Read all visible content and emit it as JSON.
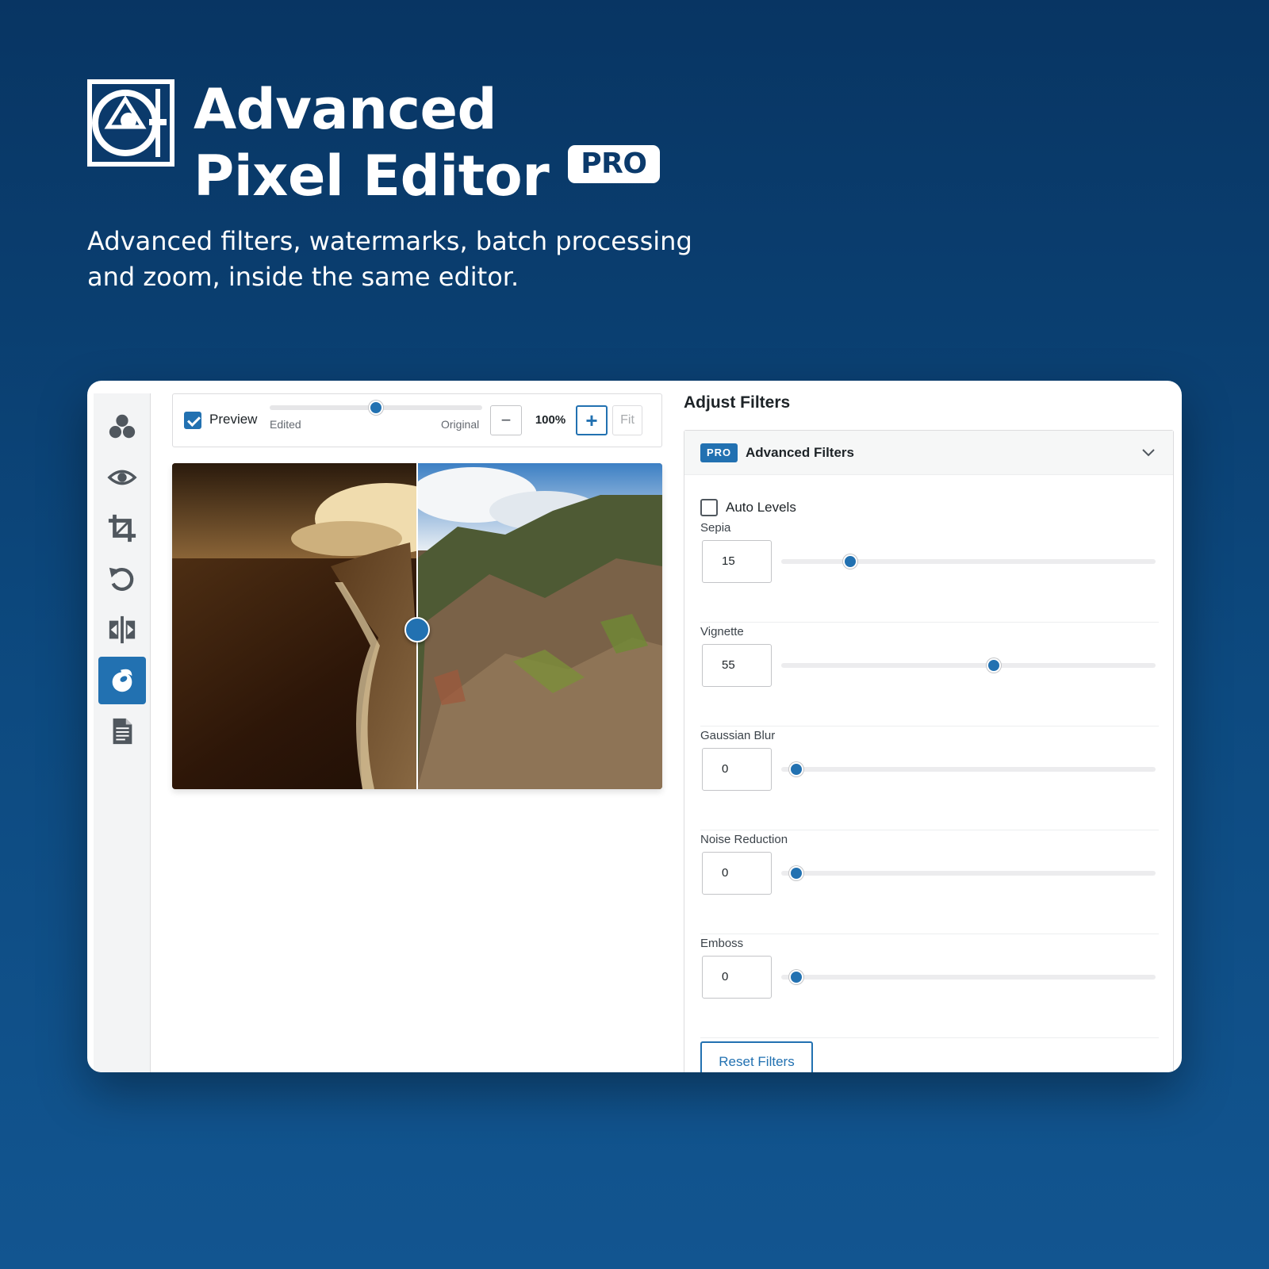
{
  "hero": {
    "title_line1": "Advanced",
    "title_line2": "Pixel Editor",
    "badge": "PRO",
    "subtitle": "Advanced filters, watermarks, batch processing and zoom, inside the same editor.",
    "logo_icon": "camera-aperture-logo"
  },
  "sidebar": {
    "items": [
      {
        "icon": "circles-icon",
        "active": false
      },
      {
        "icon": "eye-icon",
        "active": false
      },
      {
        "icon": "crop-icon",
        "active": false
      },
      {
        "icon": "rotate-icon",
        "active": false
      },
      {
        "icon": "flip-icon",
        "active": false
      },
      {
        "icon": "filter-icon",
        "active": true
      },
      {
        "icon": "document-icon",
        "active": false
      }
    ]
  },
  "toolbar": {
    "preview_label": "Preview",
    "preview_checked": true,
    "compare_slider_value": 0.5,
    "edited_label": "Edited",
    "original_label": "Original",
    "zoom_out": "−",
    "zoom_level": "100%",
    "zoom_in": "+",
    "fit_label": "Fit"
  },
  "image": {
    "split_position": 0.5
  },
  "panel": {
    "heading": "Adjust Filters",
    "section_badge": "PRO",
    "section_title": "Advanced Filters",
    "auto_levels_label": "Auto Levels",
    "auto_levels_checked": false,
    "filters": [
      {
        "label": "Sepia",
        "value": "15",
        "max": 100
      },
      {
        "label": "Vignette",
        "value": "55",
        "max": 100
      },
      {
        "label": "Gaussian Blur",
        "value": "0",
        "max": 100
      },
      {
        "label": "Noise Reduction",
        "value": "0",
        "max": 100
      },
      {
        "label": "Emboss",
        "value": "0",
        "max": 100
      }
    ],
    "reset_label": "Reset Filters"
  },
  "colors": {
    "accent": "#2271b1",
    "background_top": "#083563",
    "background_bottom": "#125590"
  }
}
